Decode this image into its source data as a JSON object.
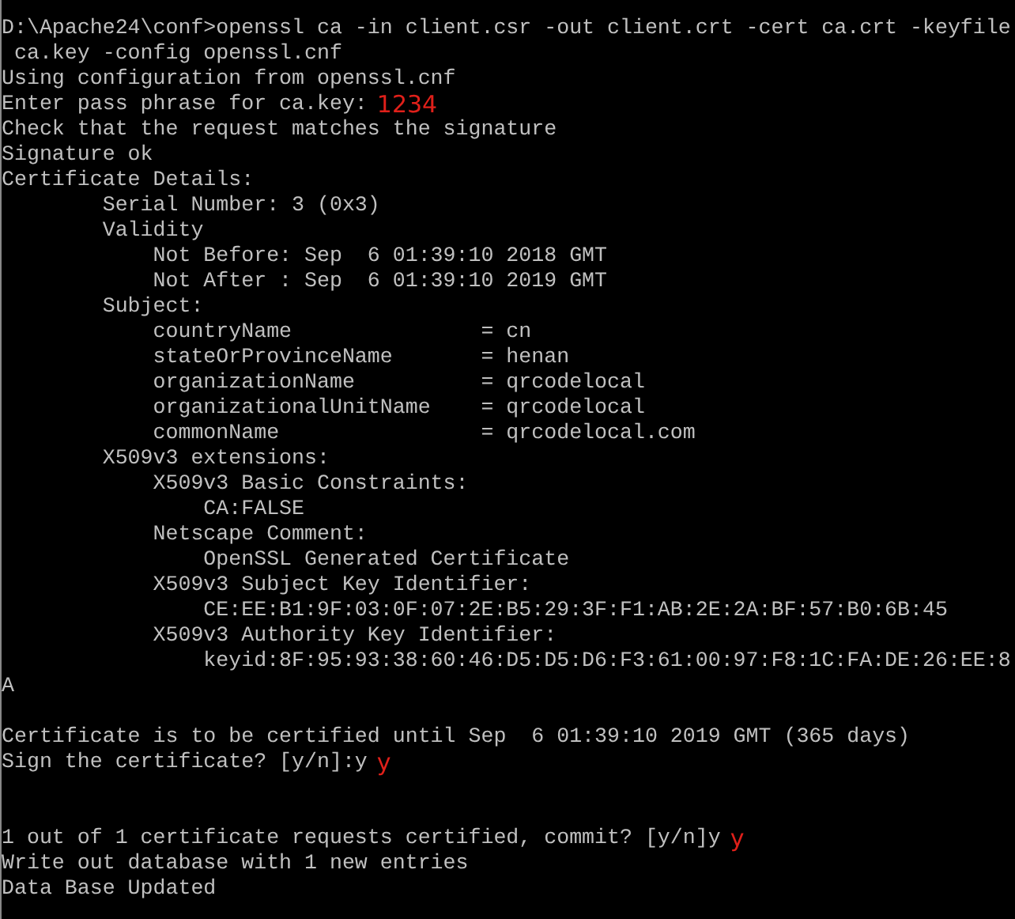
{
  "console": {
    "lines": [
      {
        "kind": "output",
        "text": "D:\\Apache24\\conf>openssl ca -in client.csr -out client.crt -cert ca.crt -keyfile"
      },
      {
        "kind": "output",
        "text": " ca.key -config openssl.cnf"
      },
      {
        "kind": "output",
        "text": "Using configuration from openssl.cnf"
      },
      {
        "kind": "output",
        "text": "Enter pass phrase for ca.key:",
        "note": "1234"
      },
      {
        "kind": "output",
        "text": "Check that the request matches the signature"
      },
      {
        "kind": "output",
        "text": "Signature ok"
      },
      {
        "kind": "output",
        "text": "Certificate Details:"
      },
      {
        "kind": "output",
        "text": "        Serial Number: 3 (0x3)"
      },
      {
        "kind": "output",
        "text": "        Validity"
      },
      {
        "kind": "output",
        "text": "            Not Before: Sep  6 01:39:10 2018 GMT"
      },
      {
        "kind": "output",
        "text": "            Not After : Sep  6 01:39:10 2019 GMT"
      },
      {
        "kind": "output",
        "text": "        Subject:"
      },
      {
        "kind": "output",
        "text": "            countryName               = cn"
      },
      {
        "kind": "output",
        "text": "            stateOrProvinceName       = henan"
      },
      {
        "kind": "output",
        "text": "            organizationName          = qrcodelocal"
      },
      {
        "kind": "output",
        "text": "            organizationalUnitName    = qrcodelocal"
      },
      {
        "kind": "output",
        "text": "            commonName                = qrcodelocal.com"
      },
      {
        "kind": "output",
        "text": "        X509v3 extensions:"
      },
      {
        "kind": "output",
        "text": "            X509v3 Basic Constraints:"
      },
      {
        "kind": "output",
        "text": "                CA:FALSE"
      },
      {
        "kind": "output",
        "text": "            Netscape Comment:"
      },
      {
        "kind": "output",
        "text": "                OpenSSL Generated Certificate"
      },
      {
        "kind": "output",
        "text": "            X509v3 Subject Key Identifier:"
      },
      {
        "kind": "output",
        "text": "                CE:EE:B1:9F:03:0F:07:2E:B5:29:3F:F1:AB:2E:2A:BF:57:B0:6B:45"
      },
      {
        "kind": "output",
        "text": "            X509v3 Authority Key Identifier:"
      },
      {
        "kind": "output",
        "text": "                keyid:8F:95:93:38:60:46:D5:D5:D6:F3:61:00:97:F8:1C:FA:DE:26:EE:8"
      },
      {
        "kind": "output",
        "text": "A"
      },
      {
        "kind": "blank"
      },
      {
        "kind": "output",
        "text": "Certificate is to be certified until Sep  6 01:39:10 2019 GMT (365 days)"
      },
      {
        "kind": "output",
        "text": "Sign the certificate? [y/n]:y",
        "note": "y"
      },
      {
        "kind": "blank"
      },
      {
        "kind": "blank"
      },
      {
        "kind": "output",
        "text": "1 out of 1 certificate requests certified, commit? [y/n]y",
        "note": "y"
      },
      {
        "kind": "output",
        "text": "Write out database with 1 new entries"
      },
      {
        "kind": "output",
        "text": "Data Base Updated"
      }
    ]
  }
}
